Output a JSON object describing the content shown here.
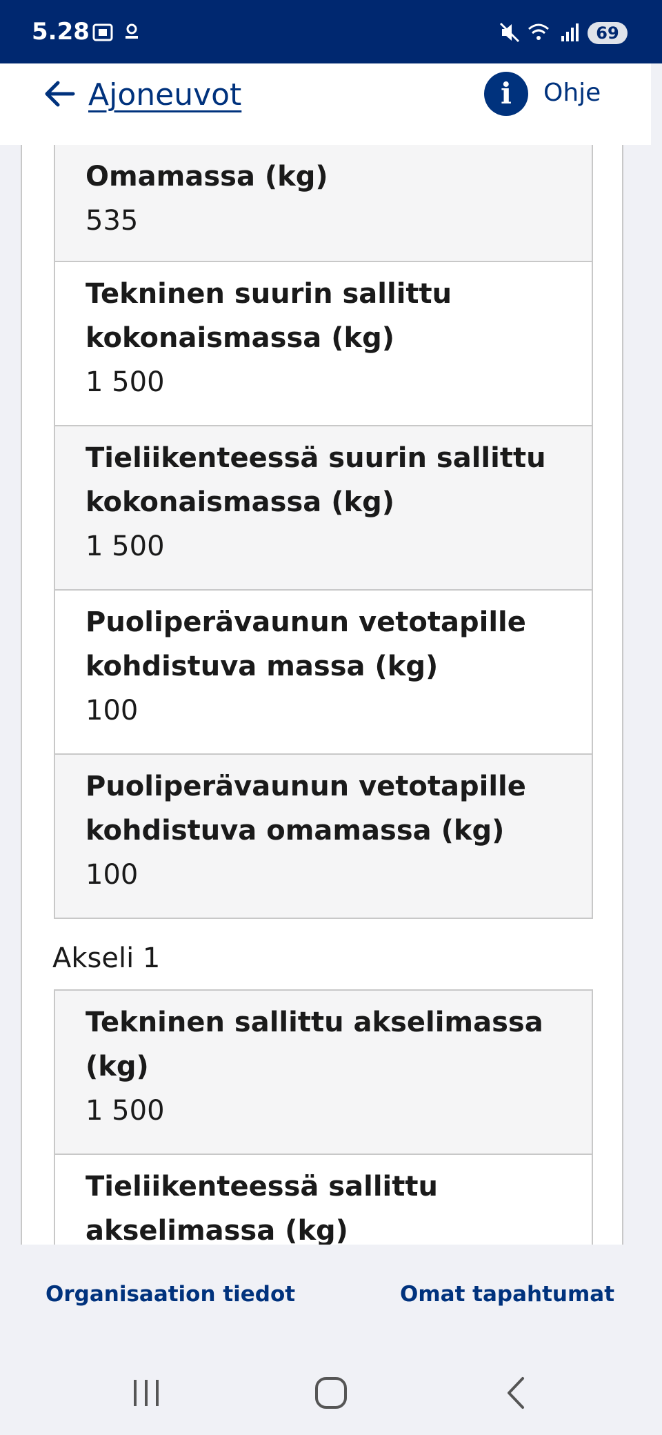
{
  "status_bar": {
    "time": "5.28",
    "battery": "69",
    "icons": [
      "screenshot-icon",
      "notification-icon",
      "mute-icon",
      "wifi-icon",
      "signal-icon"
    ]
  },
  "header": {
    "back_icon": "arrow-left-icon",
    "title": "Ajoneuvot",
    "help_icon": "info-icon",
    "help_icon_glyph": "i",
    "help_label": "Ohje"
  },
  "mass_rows": [
    {
      "label": "Omamassa (kg)",
      "value": "535"
    },
    {
      "label": "Tekninen suurin sallittu kokonaismassa (kg)",
      "value": "1 500"
    },
    {
      "label": "Tieliikenteessä suurin sallittu kokonaismassa (kg)",
      "value": "1 500"
    },
    {
      "label": "Puoliperävaunun vetotapille kohdistuva massa (kg)",
      "value": "100"
    },
    {
      "label": "Puoliperävaunun vetotapille kohdistuva omamassa (kg)",
      "value": "100"
    }
  ],
  "axle": {
    "title": "Akseli 1",
    "rows": [
      {
        "label": "Tekninen sallittu akselimassa (kg)",
        "value": "1 500"
      },
      {
        "label": "Tieliikenteessä sallittu akselimassa (kg)",
        "value": ""
      }
    ]
  },
  "footer": {
    "left_link": "Organisaation tiedot",
    "right_link": "Omat tapahtumat"
  },
  "nav_bar": {
    "icons": [
      "recent-apps-icon",
      "home-icon",
      "back-icon"
    ]
  },
  "colors": {
    "brand": "#002870",
    "link": "#00327d",
    "row_shade": "#f5f5f6",
    "border": "#c8c8c8"
  }
}
